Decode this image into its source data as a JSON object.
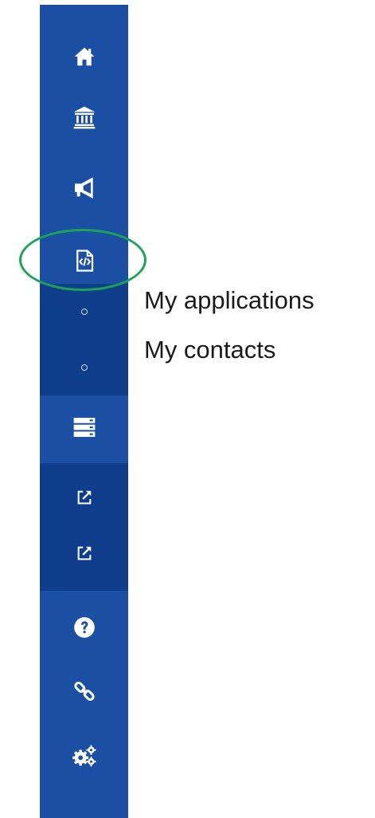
{
  "sidebar": {
    "background_color": "#1a4fa3",
    "subgroup_color": "#0e3d8c",
    "icons": [
      "home-icon",
      "institution-icon",
      "megaphone-icon",
      "file-code-icon",
      "server-icon",
      "external-link-icon",
      "external-link-icon",
      "help-icon",
      "link-icon",
      "settings-icon"
    ]
  },
  "submenu": {
    "items": [
      {
        "label": "My applications"
      },
      {
        "label": "My contacts"
      }
    ]
  },
  "highlight": {
    "color": "#1aa354"
  }
}
